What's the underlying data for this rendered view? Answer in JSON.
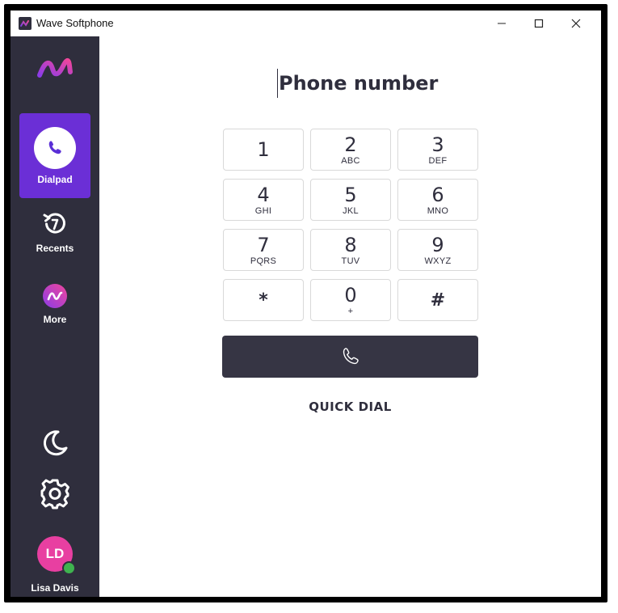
{
  "window": {
    "title": "Wave Softphone",
    "controls": [
      "minimize-icon",
      "maximize-icon",
      "close-icon"
    ]
  },
  "sidebar": {
    "logo_icon": "wave-logo-icon",
    "nav": [
      {
        "label": "Dialpad",
        "icon": "phone-icon",
        "active": true
      },
      {
        "label": "Recents",
        "icon": "recents-icon",
        "active": false
      },
      {
        "label": "More",
        "icon": "wave-logo-icon",
        "active": false
      }
    ],
    "bottom_icons": [
      "moon-icon",
      "gear-icon"
    ],
    "user": {
      "initials": "LD",
      "name": "Lisa Davis",
      "status_color": "#3fb34f"
    }
  },
  "dialer": {
    "placeholder": "Phone number",
    "value": "",
    "keys": [
      {
        "digit": "1",
        "letters": ""
      },
      {
        "digit": "2",
        "letters": "ABC"
      },
      {
        "digit": "3",
        "letters": "DEF"
      },
      {
        "digit": "4",
        "letters": "GHI"
      },
      {
        "digit": "5",
        "letters": "JKL"
      },
      {
        "digit": "6",
        "letters": "MNO"
      },
      {
        "digit": "7",
        "letters": "PQRS"
      },
      {
        "digit": "8",
        "letters": "TUV"
      },
      {
        "digit": "9",
        "letters": "WXYZ"
      },
      {
        "digit": "*",
        "letters": ""
      },
      {
        "digit": "0",
        "letters": "+"
      },
      {
        "digit": "#",
        "letters": ""
      }
    ],
    "call_icon": "phone-icon",
    "quick_dial_label": "QUICK DIAL"
  },
  "colors": {
    "sidebar_bg": "#2f2e3d",
    "active_nav": "#6b2fd6",
    "avatar": "#e83fa1",
    "call_button": "#363544"
  }
}
